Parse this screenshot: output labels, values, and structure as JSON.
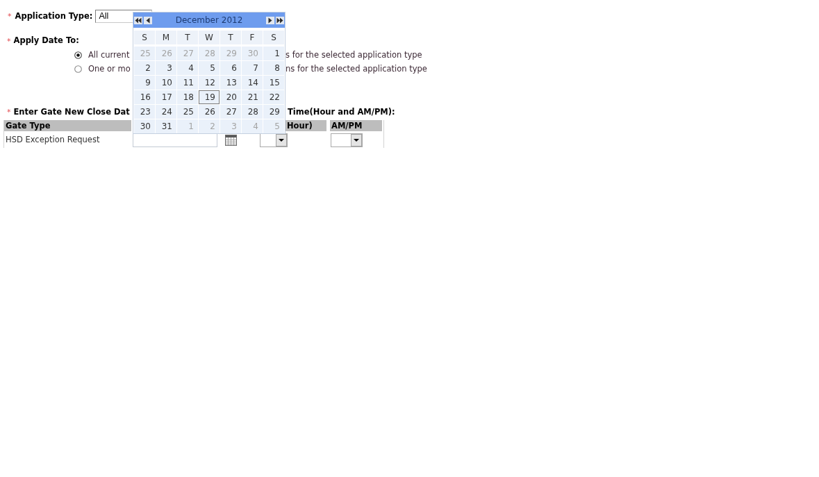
{
  "application_type": {
    "marker": "*",
    "label": "Application Type:",
    "value": "All"
  },
  "apply_date_to": {
    "marker": "*",
    "label": "Apply Date To:",
    "options": [
      {
        "text_start": "All current",
        "text_end": "s for the selected application type",
        "selected": true
      },
      {
        "text_start": "One or mo",
        "text_end": "ns for the selected application type",
        "selected": false
      }
    ]
  },
  "close_date": {
    "marker": "*",
    "label_start": "Enter Gate New Close Dat",
    "label_end": "Time(Hour and AM/PM):"
  },
  "gate_table": {
    "columns": [
      {
        "label": "Gate Type"
      },
      {
        "label": "Hour)"
      },
      {
        "label": "AM/PM"
      }
    ],
    "rows": [
      {
        "gate_type": "HSD Exception Request"
      }
    ]
  },
  "calendar": {
    "title": "December 2012",
    "weekdays": [
      "S",
      "M",
      "T",
      "W",
      "T",
      "F",
      "S"
    ],
    "weeks": [
      [
        {
          "day": "25",
          "in_month": false,
          "today": false
        },
        {
          "day": "26",
          "in_month": false,
          "today": false
        },
        {
          "day": "27",
          "in_month": false,
          "today": false
        },
        {
          "day": "28",
          "in_month": false,
          "today": false
        },
        {
          "day": "29",
          "in_month": false,
          "today": false
        },
        {
          "day": "30",
          "in_month": false,
          "today": false
        },
        {
          "day": "1",
          "in_month": true,
          "today": false
        }
      ],
      [
        {
          "day": "2",
          "in_month": true,
          "today": false
        },
        {
          "day": "3",
          "in_month": true,
          "today": false
        },
        {
          "day": "4",
          "in_month": true,
          "today": false
        },
        {
          "day": "5",
          "in_month": true,
          "today": false
        },
        {
          "day": "6",
          "in_month": true,
          "today": false
        },
        {
          "day": "7",
          "in_month": true,
          "today": false
        },
        {
          "day": "8",
          "in_month": true,
          "today": false
        }
      ],
      [
        {
          "day": "9",
          "in_month": true,
          "today": false
        },
        {
          "day": "10",
          "in_month": true,
          "today": false
        },
        {
          "day": "11",
          "in_month": true,
          "today": false
        },
        {
          "day": "12",
          "in_month": true,
          "today": false
        },
        {
          "day": "13",
          "in_month": true,
          "today": false
        },
        {
          "day": "14",
          "in_month": true,
          "today": false
        },
        {
          "day": "15",
          "in_month": true,
          "today": false
        }
      ],
      [
        {
          "day": "16",
          "in_month": true,
          "today": false
        },
        {
          "day": "17",
          "in_month": true,
          "today": false
        },
        {
          "day": "18",
          "in_month": true,
          "today": false
        },
        {
          "day": "19",
          "in_month": true,
          "today": true
        },
        {
          "day": "20",
          "in_month": true,
          "today": false
        },
        {
          "day": "21",
          "in_month": true,
          "today": false
        },
        {
          "day": "22",
          "in_month": true,
          "today": false
        }
      ],
      [
        {
          "day": "23",
          "in_month": true,
          "today": false
        },
        {
          "day": "24",
          "in_month": true,
          "today": false
        },
        {
          "day": "25",
          "in_month": true,
          "today": false
        },
        {
          "day": "26",
          "in_month": true,
          "today": false
        },
        {
          "day": "27",
          "in_month": true,
          "today": false
        },
        {
          "day": "28",
          "in_month": true,
          "today": false
        },
        {
          "day": "29",
          "in_month": true,
          "today": false
        }
      ],
      [
        {
          "day": "30",
          "in_month": true,
          "today": false
        },
        {
          "day": "31",
          "in_month": true,
          "today": false
        },
        {
          "day": "1",
          "in_month": false,
          "today": false
        },
        {
          "day": "2",
          "in_month": false,
          "today": false
        },
        {
          "day": "3",
          "in_month": false,
          "today": false
        },
        {
          "day": "4",
          "in_month": false,
          "today": false
        },
        {
          "day": "5",
          "in_month": false,
          "today": false
        }
      ]
    ]
  }
}
